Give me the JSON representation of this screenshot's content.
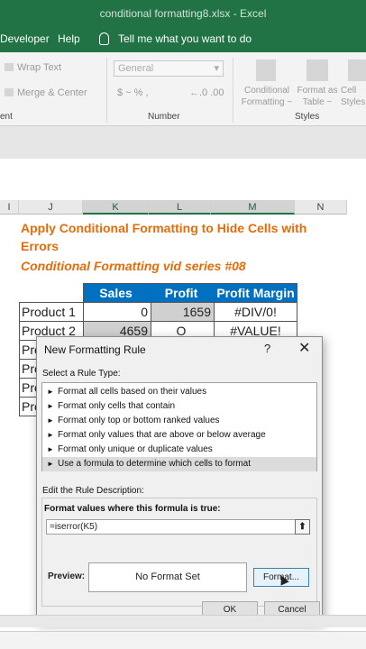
{
  "window": {
    "title": "conditional formatting8.xlsx  -  Excel"
  },
  "menu": {
    "developer": "Developer",
    "help": "Help",
    "tell_me": "Tell me what you want to do"
  },
  "ribbon": {
    "wrap_text": "Wrap Text",
    "merge_center": "Merge & Center",
    "alignment_group_partial": "ent",
    "number_format": "General",
    "number_symbols": "$  ~  %  ,",
    "number_decimals": "←.0  .00",
    "number_group": "Number",
    "conditional_formatting": "Conditional Formatting ~",
    "format_as_table": "Format as Table ~",
    "cell_styles": "Cell Styles",
    "styles_group": "Styles"
  },
  "columns": [
    "I",
    "J",
    "K",
    "L",
    "M",
    "N"
  ],
  "sheet": {
    "heading1": "Apply Conditional Formatting to Hide Cells with Errors",
    "heading2": "Conditional Formatting vid series #08",
    "table": {
      "headers": [
        "Sales",
        "Profit",
        "Profit Margin"
      ],
      "rows": [
        {
          "product": "Product 1",
          "sales": "0",
          "profit": "1659",
          "margin": "#DIV/0!"
        },
        {
          "product": "Product 2",
          "sales": "4659",
          "profit": "O",
          "margin": "#VALUE!"
        }
      ],
      "partial_rows": [
        "Pro",
        "Pro",
        "Pro",
        "Pro"
      ]
    }
  },
  "dialog": {
    "title": "New Formatting Rule",
    "help_glyph": "?",
    "close_glyph": "✕",
    "select_rule_type_label": "Select a Rule Type:",
    "rule_types": [
      "Format all cells based on their values",
      "Format only cells that contain",
      "Format only top or bottom ranked values",
      "Format only values that are above or below average",
      "Format only unique or duplicate values",
      "Use a formula to determine which cells to format"
    ],
    "selected_rule_index": 5,
    "edit_description_label": "Edit the Rule Description:",
    "formula_label": "Format values where this formula is true:",
    "formula_value": "=iserror(K5)",
    "preview_label": "Preview:",
    "preview_text": "No Format Set",
    "format_button": "Format...",
    "ok_button": "OK",
    "cancel_button": "Cancel"
  },
  "colors": {
    "excel_green": "#217346",
    "accent_orange": "#e46c0a",
    "table_header_blue": "#0070c0"
  }
}
